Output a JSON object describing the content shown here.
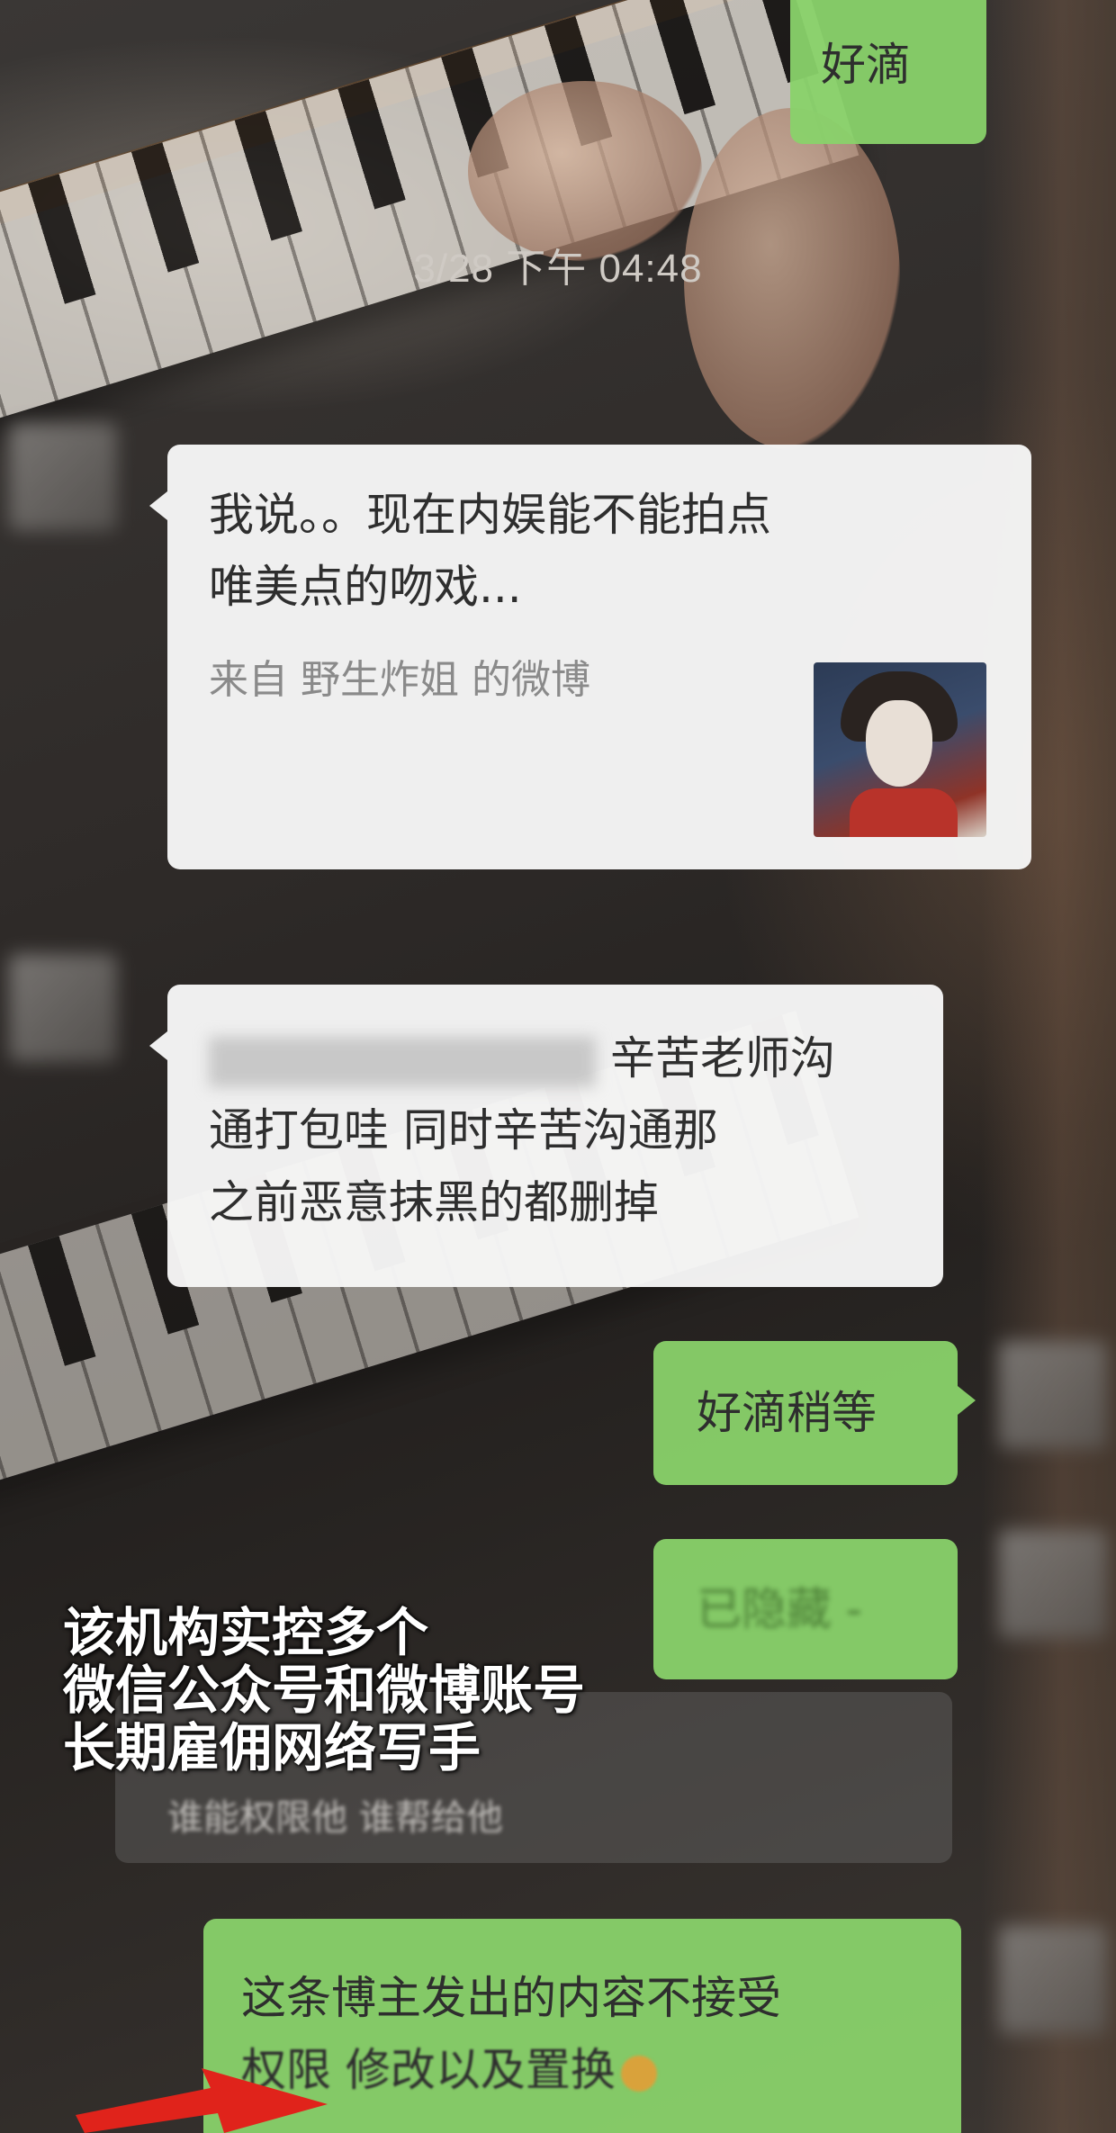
{
  "timestamp": "3/28 下午 04:48",
  "messages": [
    {
      "side": "right",
      "text": "好滴"
    },
    {
      "side": "left",
      "line1": "我说。。现在内娱能不能拍点",
      "line2": "唯美点的吻戏...",
      "source": "来自 野生炸姐 的微博"
    },
    {
      "side": "left",
      "line1": "辛苦老师沟",
      "line2": "通打包哇 同时辛苦沟通那",
      "line3": "之前恶意抹黑的都删掉"
    },
    {
      "side": "right",
      "text": "好滴稍等"
    },
    {
      "side": "right",
      "text": "已隐藏 -"
    },
    {
      "side": "left",
      "text": "谁能权限他 谁帮给他"
    },
    {
      "side": "right",
      "line1": "这条博主发出的内容不接受",
      "line2": "权限 修改以及置换"
    }
  ],
  "caption": {
    "line1": "该机构实控多个",
    "line2": "微信公众号和微博账号",
    "line3": "长期雇佣网络写手"
  },
  "colors": {
    "green_bubble": "#89d26a",
    "white_bubble": "#f6f6f6",
    "arrow": "#e0231b"
  }
}
